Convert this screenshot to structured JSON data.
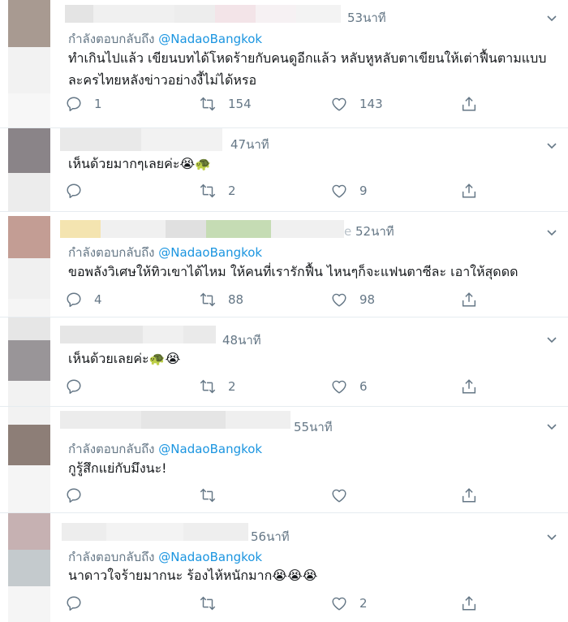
{
  "tweets": [
    {
      "time": "53นาที",
      "replying_prefix": "กำลังตอบกลับถึง",
      "mention": "@NadaoBangkok",
      "text": "ทำเกินไปแล้ว เขียนบทได้โหดร้ายกับคนดูอีกแล้ว หลับหูหลับตาเขียนให้เต่าฟื้นตามแบบละครไทยหลังข่าวอย่างงี้ไม่ได้หรอ",
      "replies": "1",
      "retweets": "154",
      "likes": "143"
    },
    {
      "time": "47นาที",
      "replying_prefix": "",
      "mention": "",
      "text": "เห็นด้วยมากๆเลยค่ะ😭🐢",
      "replies": "",
      "retweets": "2",
      "likes": "9"
    },
    {
      "time": "52นาที",
      "name_fragment": "e",
      "replying_prefix": "กำลังตอบกลับถึง",
      "mention": "@NadaoBangkok",
      "text": "ขอพลังวิเศษให้ทิวเขาได้ไหม ให้คนที่เรารักฟื้น ไหนๆก็จะแฟนตาซีละ เอาให้สุดดด",
      "replies": "4",
      "retweets": "88",
      "likes": "98"
    },
    {
      "time": "48นาที",
      "replying_prefix": "",
      "mention": "",
      "text": "เห็นด้วยเลยค่ะ🐢😭",
      "replies": "",
      "retweets": "2",
      "likes": "6"
    },
    {
      "time": "55นาที",
      "replying_prefix": "กำลังตอบกลับถึง",
      "mention": "@NadaoBangkok",
      "text": "กูรู้สึกแย่กับมึงนะ!",
      "replies": "",
      "retweets": "",
      "likes": ""
    },
    {
      "time": "56นาที",
      "replying_prefix": "กำลังตอบกลับถึง",
      "mention": "@NadaoBangkok",
      "text": "นาดาวใจร้ายมากนะ ร้องไห้หนักมาก😭😭😭",
      "replies": "",
      "retweets": "",
      "likes": "2"
    }
  ],
  "icons": {
    "reply": "reply-icon",
    "retweet": "retweet-icon",
    "like": "like-icon",
    "share": "share-icon",
    "more": "chevron-down-icon"
  },
  "colors": {
    "text": "#14171a",
    "secondary": "#657786",
    "link": "#1b95e0",
    "divider": "#e6ecf0"
  }
}
